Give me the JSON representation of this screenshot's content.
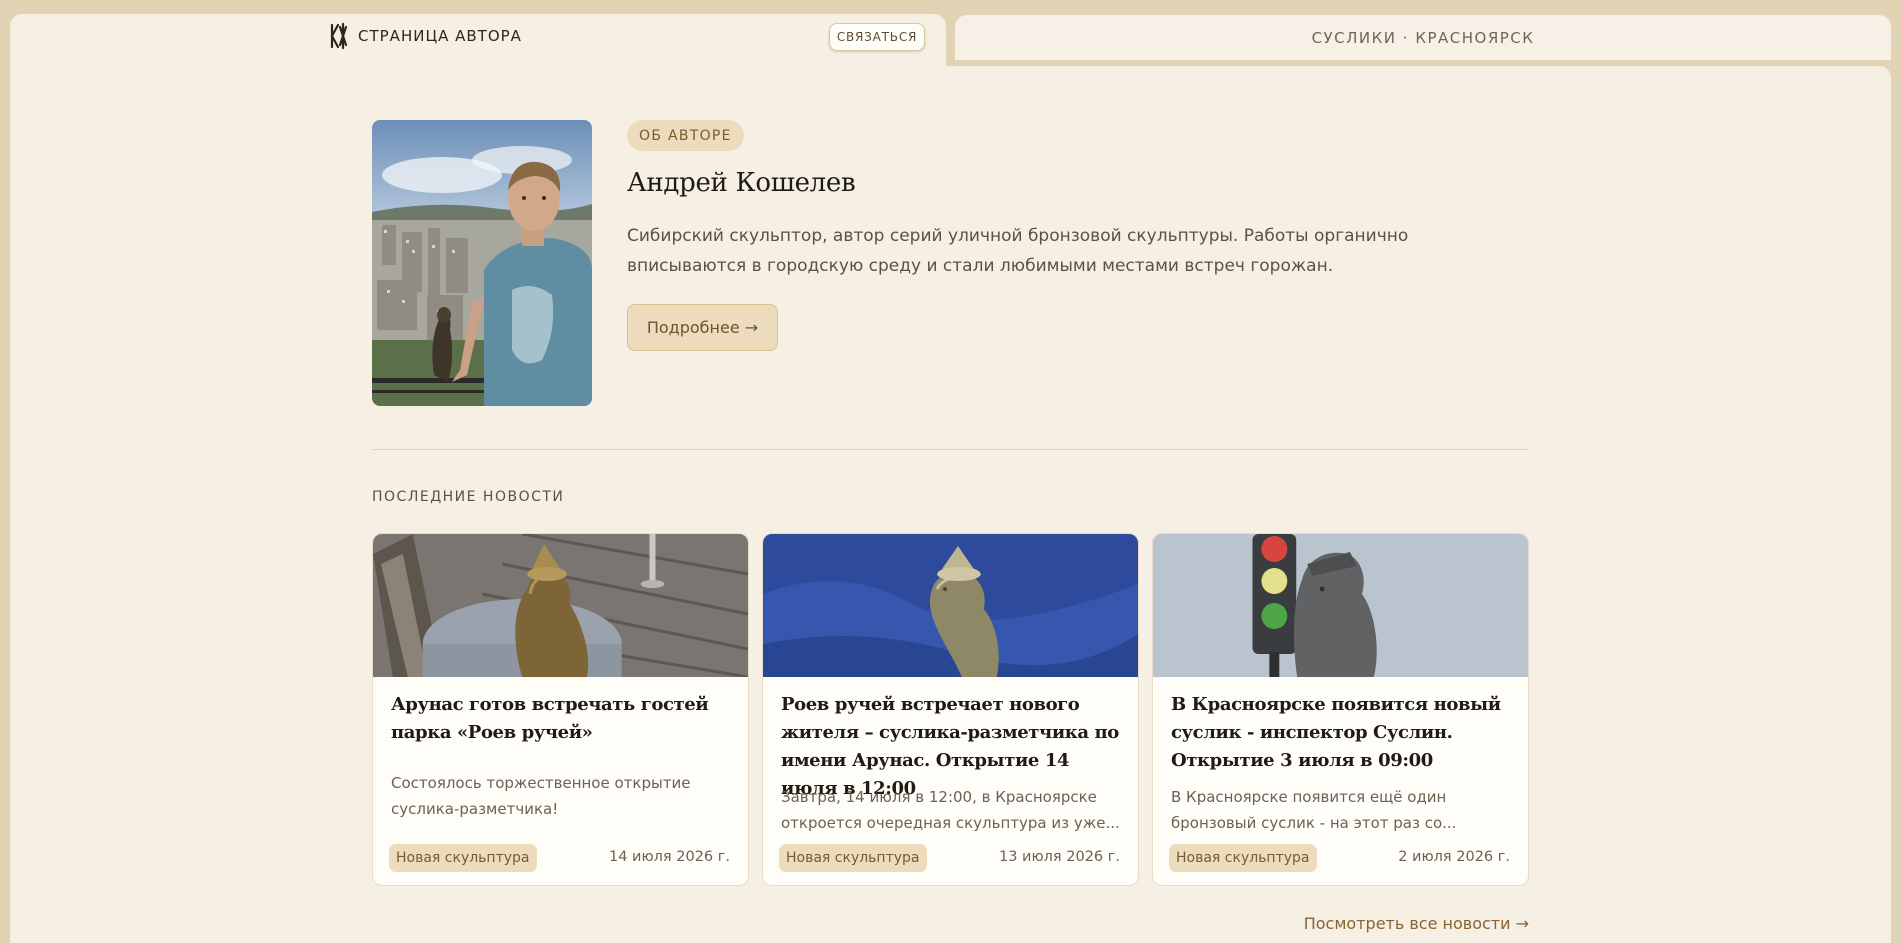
{
  "header": {
    "brand": "СТРАНИЦА АВТОРА",
    "contact_button": "СВЯЗАТЬСЯ",
    "right_tab": "СУСЛИКИ · КРАСНОЯРСК"
  },
  "author": {
    "badge": "ОБ АВТОРЕ",
    "name": "Андрей Кошелев",
    "bio": "Сибирский скульптор, автор серий уличной бронзовой скульптуры. Работы органично вписываются в городскую среду и стали любимыми местами встреч горожан.",
    "more_button": "Подробнее →"
  },
  "news": {
    "heading": "ПОСЛЕДНИЕ НОВОСТИ",
    "all_link": "Посмотреть все новости →",
    "items": [
      {
        "title": "Арунас готов встречать гостей парка «Роев ручей»",
        "excerpt": "Состоялось торжественное открытие суслика-разметчика!",
        "tag": "Новая скульптура",
        "date": "14 июля 2026 г."
      },
      {
        "title": "Роев ручей встречает нового жителя – суслика-разметчика по имени Арунас. Открытие 14 июля в 12:00",
        "excerpt": "Завтра, 14 июля в 12:00, в Красноярске откроется очередная скульптура из уже...",
        "tag": "Новая скульптура",
        "date": "13 июля 2026 г."
      },
      {
        "title": "В Красноярске появится новый суслик - инспектор Суслин. Открытие 3 июля в 09:00",
        "excerpt": "В Красноярске появится ещё один бронзовый суслик - на этот раз со...",
        "tag": "Новая скульптура",
        "date": "2 июля 2026 г."
      }
    ]
  },
  "colors": {
    "background": "#e2d3b5",
    "panel": "#f5efe4",
    "accent": "#ecdcbd",
    "accent_text": "#7a5b2b",
    "link": "#8a6331"
  }
}
